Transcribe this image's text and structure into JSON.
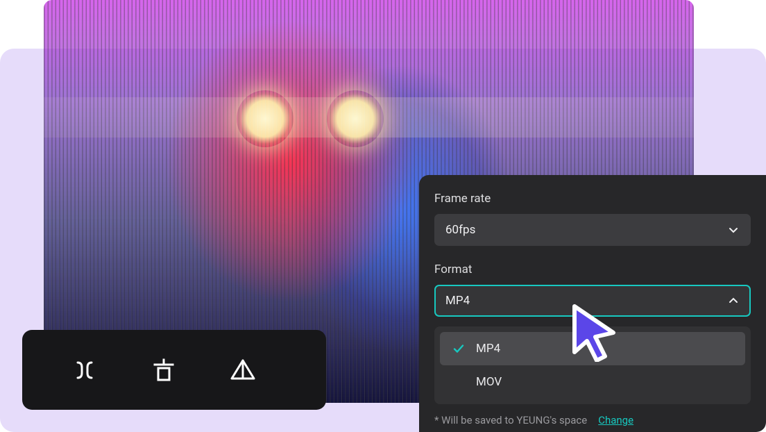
{
  "toolbar": {
    "icons": [
      "split-icon",
      "delete-icon",
      "mirror-icon"
    ]
  },
  "panel": {
    "frameRate": {
      "label": "Frame rate",
      "value": "60fps"
    },
    "format": {
      "label": "Format",
      "value": "MP4",
      "options": [
        "MP4",
        "MOV"
      ],
      "selected": "MP4"
    },
    "saveNote": "* Will be saved to YEUNG's space",
    "changeLink": "Change"
  },
  "colors": {
    "accent": "#17c9c0",
    "panelBg": "#272729",
    "toolbarBg": "#171719",
    "cursor": "#5b46e8"
  }
}
